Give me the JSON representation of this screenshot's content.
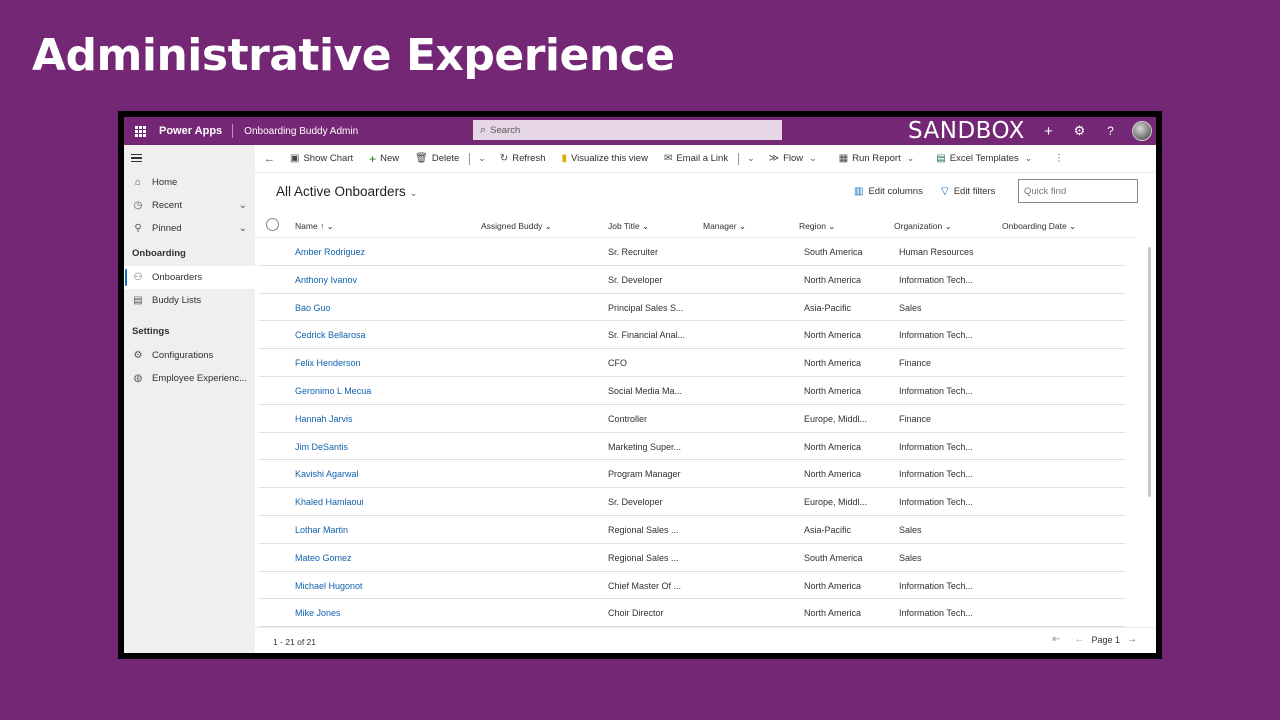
{
  "slide": {
    "title": "Administrative Experience"
  },
  "topbar": {
    "brand": "Power Apps",
    "app_name": "Onboarding Buddy Admin",
    "search_placeholder": "Search",
    "environment": "SANDBOX",
    "icons": [
      "waffle-icon",
      "plus-icon",
      "gear-icon",
      "help-icon",
      "avatar"
    ]
  },
  "sidebar": {
    "top_items": [
      {
        "label": "Home",
        "icon": "home-icon"
      },
      {
        "label": "Recent",
        "icon": "clock-icon"
      },
      {
        "label": "Pinned",
        "icon": "pin-icon"
      }
    ],
    "groups": [
      {
        "label": "Onboarding",
        "items": [
          {
            "label": "Onboarders",
            "icon": "people-icon",
            "active": true
          },
          {
            "label": "Buddy Lists",
            "icon": "list-icon"
          }
        ]
      },
      {
        "label": "Settings",
        "items": [
          {
            "label": "Configurations",
            "icon": "gear-icon"
          },
          {
            "label": "Employee Experienc...",
            "icon": "globe-icon"
          }
        ]
      }
    ]
  },
  "commandbar": {
    "show_chart": "Show Chart",
    "new": "New",
    "delete": "Delete",
    "refresh": "Refresh",
    "visualize": "Visualize this view",
    "email_link": "Email a Link",
    "flow": "Flow",
    "run_report": "Run Report",
    "excel_templates": "Excel Templates"
  },
  "view": {
    "title": "All Active Onboarders",
    "edit_columns": "Edit columns",
    "edit_filters": "Edit filters",
    "quick_find_placeholder": "Quick find"
  },
  "grid": {
    "columns": [
      "Name",
      "Assigned Buddy",
      "Job Title",
      "Manager",
      "Region",
      "Organization",
      "Onboarding Date"
    ],
    "rows": [
      {
        "name": "Amber Rodriguez",
        "job": "Sr. Recruiter",
        "region": "South America",
        "org": "Human Resources"
      },
      {
        "name": "Anthony Ivanov",
        "job": "Sr. Developer",
        "region": "North America",
        "org": "Information Tech..."
      },
      {
        "name": "Bao Guo",
        "job": "Principal Sales S...",
        "region": "Asia-Pacific",
        "org": "Sales"
      },
      {
        "name": "Cedrick Bellarosa",
        "job": "Sr. Financial Anal...",
        "region": "North America",
        "org": "Information Tech..."
      },
      {
        "name": "Felix Henderson",
        "job": "CFO",
        "region": "North America",
        "org": "Finance"
      },
      {
        "name": "Geronimo L Mecua",
        "job": "Social Media Ma...",
        "region": "North America",
        "org": "Information Tech..."
      },
      {
        "name": "Hannah Jarvis",
        "job": "Controller",
        "region": "Europe, Middl...",
        "org": "Finance"
      },
      {
        "name": "Jim DeSantis",
        "job": "Marketing Super...",
        "region": "North America",
        "org": "Information Tech..."
      },
      {
        "name": "Kavishi Agarwal",
        "job": "Program Manager",
        "region": "North America",
        "org": "Information Tech..."
      },
      {
        "name": "Khaled Hamlaoui",
        "job": "Sr. Developer",
        "region": "Europe, Middl...",
        "org": "Information Tech..."
      },
      {
        "name": "Lothar Martin",
        "job": "Regional Sales ...",
        "region": "Asia-Pacific",
        "org": "Sales"
      },
      {
        "name": "Mateo Gomez",
        "job": "Regional Sales ...",
        "region": "South America",
        "org": "Sales"
      },
      {
        "name": "Michael Hugonot",
        "job": "Chief Master Of ...",
        "region": "North America",
        "org": "Information Tech..."
      },
      {
        "name": "Mike Jones",
        "job": "Choir Director",
        "region": "North America",
        "org": "Information Tech..."
      }
    ]
  },
  "footer": {
    "record_count": "1 - 21 of 21",
    "page": "Page 1"
  }
}
